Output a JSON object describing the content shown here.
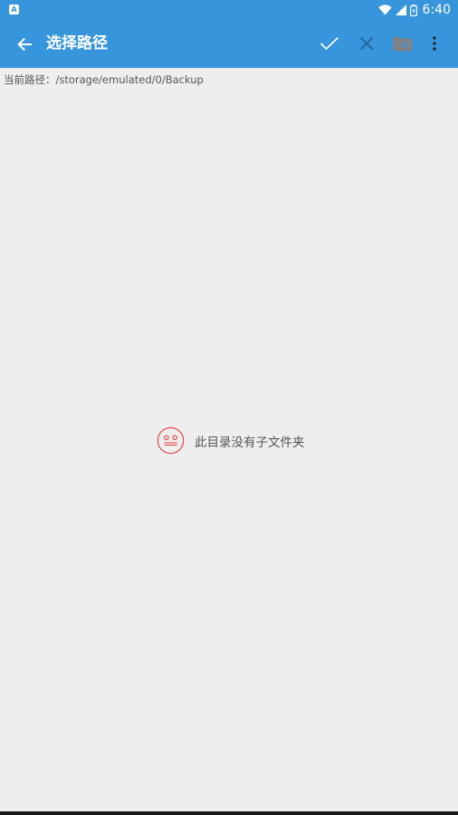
{
  "status_bar": {
    "time": "6:40",
    "notification_badge": "A"
  },
  "toolbar": {
    "title": "选择路径",
    "icons": {
      "back": "arrow-left-icon",
      "confirm": "check-icon",
      "cancel": "close-icon",
      "new_folder": "folder-add-icon",
      "more": "more-vert-icon"
    }
  },
  "path": {
    "label": "当前路径：",
    "value": "/storage/emulated/0/Backup"
  },
  "empty_state": {
    "message": "此目录没有子文件夹",
    "icon": "neutral-face-icon"
  },
  "colors": {
    "primary": "#3796db",
    "background": "#eeeeee",
    "empty_icon": "#e5383c",
    "text_secondary": "#555555"
  }
}
